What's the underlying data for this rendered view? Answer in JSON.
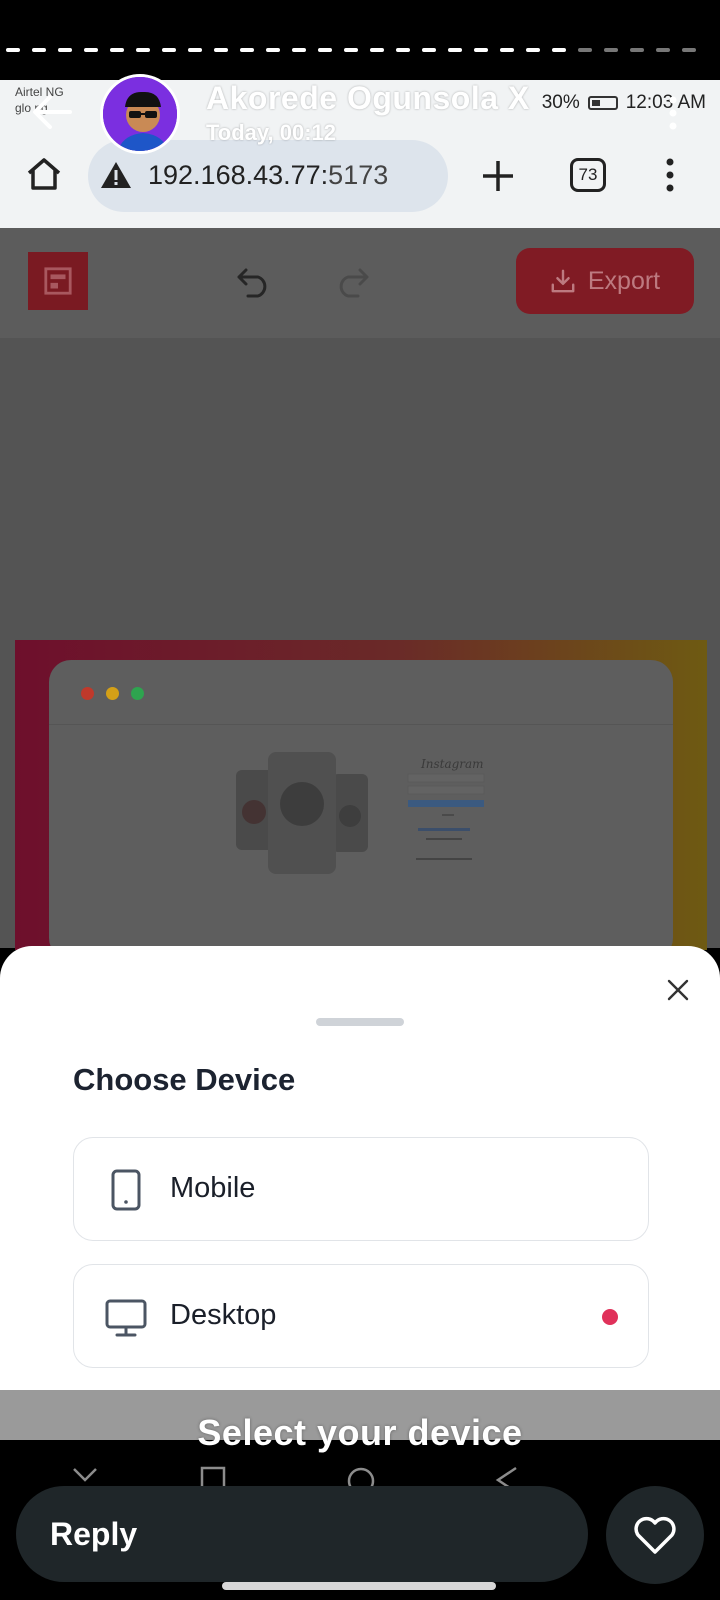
{
  "story": {
    "user_name": "Akorede Ogunsola X",
    "posted_time": "Today, 00:12",
    "caption": "Select your device",
    "reply_placeholder": "Reply",
    "icons": {
      "back": "arrow-left-icon",
      "more": "more-vertical-icon",
      "like": "heart-icon"
    }
  },
  "status_bar": {
    "carrier": "Airtel NG\nglo ng",
    "battery": "30%",
    "time": "12:03 AM"
  },
  "browser": {
    "url_host": "192.168.43.77:",
    "url_port": "5173",
    "tab_count": "73",
    "icons": {
      "home": "home-icon",
      "warning": "warning-icon",
      "new_tab": "plus-icon",
      "menu": "more-vertical-icon"
    }
  },
  "app_toolbar": {
    "export_label": "Export",
    "icons": {
      "logo": "layout-icon",
      "undo": "undo-icon",
      "redo": "redo-icon",
      "export": "download-icon"
    }
  },
  "preview": {
    "mock_brand_text": "Instagram",
    "window_dots": [
      "#c0392b",
      "#d4a017",
      "#2ea44f"
    ]
  },
  "sheet": {
    "title": "Choose Device",
    "options": [
      {
        "label": "Mobile",
        "icon": "smartphone-icon",
        "selected": false
      },
      {
        "label": "Desktop",
        "icon": "monitor-icon",
        "selected": true
      }
    ],
    "accent_color": "#e0315a"
  }
}
